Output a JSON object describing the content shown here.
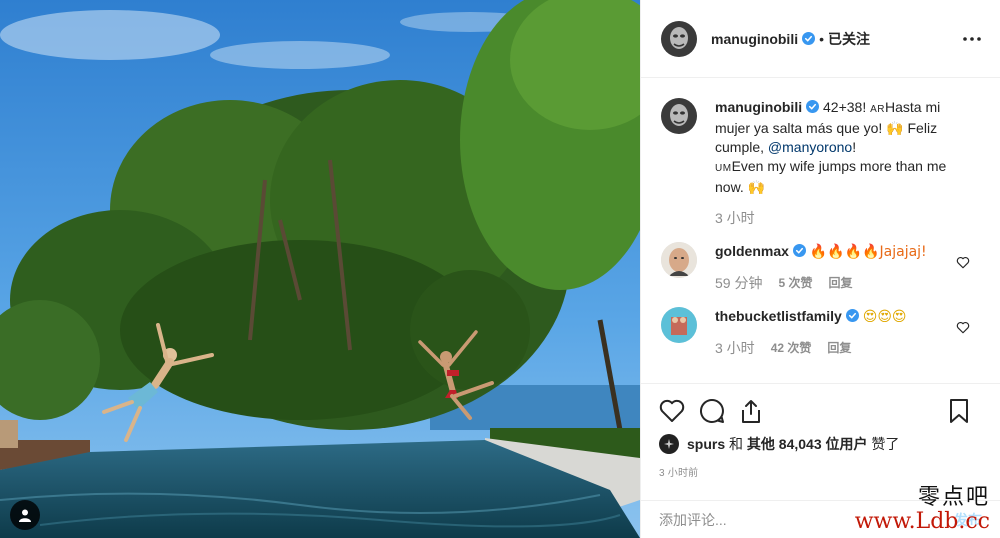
{
  "post": {
    "author": "manuginobili",
    "dot": "•",
    "follow_label": "已关注",
    "caption": {
      "user": "manuginobili",
      "text_a": "42+38! ",
      "flag_a": "AR",
      "text_b": "Hasta mi mujer ya salta más que yo! 🙌 Feliz cumple, ",
      "mention": "@manyorono",
      "text_c": "! ",
      "flag_b": "UM",
      "text_d": "Even my wife jumps more than me now. 🙌",
      "time": "3 小时"
    },
    "comments": [
      {
        "user": "goldenmax",
        "text": "🔥🔥🔥🔥Jajajaj!",
        "time": "59 分钟",
        "likes": "5 次赞",
        "reply": "回复"
      },
      {
        "user": "thebucketlistfamily",
        "text": "😍😍😍",
        "time": "3 小时",
        "likes": "42 次赞",
        "reply": "回复"
      }
    ],
    "likes_line": {
      "user": "spurs",
      "and": " 和 ",
      "others": "其他 84,043 位用户",
      "suffix": " 赞了"
    },
    "timestamp": "3 小时前",
    "add_comment_placeholder": "添加评论...",
    "post_label": "发布"
  },
  "watermark": {
    "line1": "零点吧",
    "line2": "www.Ldb.cc"
  },
  "icons": [
    "more-options-icon",
    "heart-icon",
    "comment-icon",
    "share-icon",
    "bookmark-icon",
    "user-tag-icon",
    "verified-badge-icon"
  ],
  "colors": {
    "verified": "#3897f0",
    "mention": "#00376b",
    "muted": "#8e8e8e",
    "post_button": "#b2dffc"
  }
}
